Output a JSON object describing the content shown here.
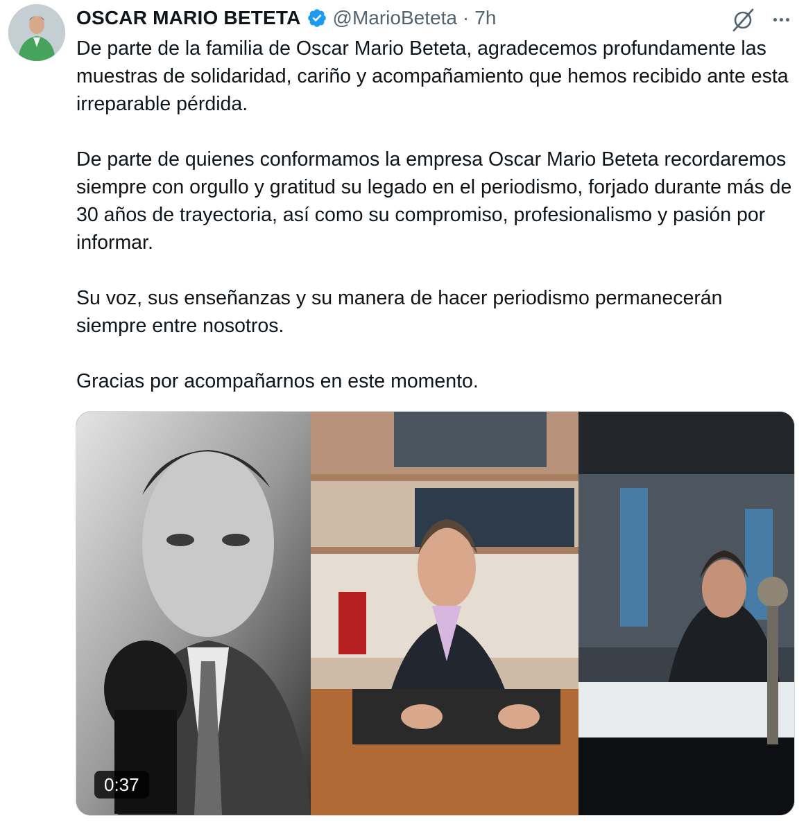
{
  "tweet": {
    "author_name": "OSCAR MARIO BETETA",
    "handle": "@MarioBeteta",
    "separator": "·",
    "time": "7h",
    "paragraphs": [
      "De parte de la familia de Oscar Mario Beteta, agradecemos profundamente las muestras de solidaridad, cariño y acompañamiento que hemos recibido ante esta irreparable pérdida.",
      "De parte de quienes conformamos la empresa Oscar Mario Beteta recordaremos siempre con orgullo y gratitud su legado en el periodismo, forjado durante más de 30 años de trayectoria, así como su compromiso, profesionalismo y pasión por informar.",
      "Su voz, sus enseñanzas y su manera de hacer periodismo permanecerán siempre entre nosotros.",
      "Gracias por acompañarnos en este momento."
    ],
    "media": {
      "duration": "0:37"
    }
  },
  "icons": {
    "verified": "verified-badge-icon",
    "grok": "grok-icon",
    "more": "more-options-icon"
  },
  "colors": {
    "verified_blue": "#1d9bf0",
    "secondary_text": "#536471",
    "primary_text": "#0f1419"
  }
}
